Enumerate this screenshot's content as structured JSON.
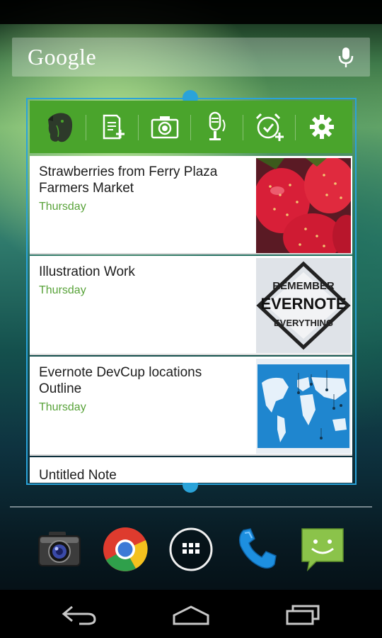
{
  "search": {
    "logo_text": "Google",
    "mic_icon": "microphone-icon"
  },
  "widget": {
    "toolbar": {
      "buttons": [
        {
          "name": "evernote-elephant-icon"
        },
        {
          "name": "new-note-icon"
        },
        {
          "name": "camera-snapshot-icon"
        },
        {
          "name": "audio-note-icon"
        },
        {
          "name": "reminder-alarm-icon"
        },
        {
          "name": "settings-gear-icon"
        }
      ],
      "color": "#4aa42c"
    },
    "notes": [
      {
        "title": "Strawberries from Ferry Plaza Farmers Market",
        "date": "Thursday"
      },
      {
        "title": "Illustration Work",
        "date": "Thursday"
      },
      {
        "title": "Evernote DevCup locations Outline",
        "date": "Thursday"
      },
      {
        "title": "Untitled Note"
      }
    ],
    "thumbnail_text": {
      "line1": "REMEMBER",
      "line2": "EVERNOTE",
      "line3": "EVERYTHING"
    },
    "date_color": "#59a33a",
    "frame_color": "#2aa3d9"
  },
  "dock": {
    "items": [
      {
        "name": "camera-app-icon"
      },
      {
        "name": "chrome-app-icon"
      },
      {
        "name": "app-drawer-icon"
      },
      {
        "name": "phone-app-icon"
      },
      {
        "name": "messaging-app-icon"
      }
    ]
  },
  "navbar": {
    "buttons": [
      {
        "name": "back-icon"
      },
      {
        "name": "home-icon"
      },
      {
        "name": "recent-apps-icon"
      }
    ]
  }
}
